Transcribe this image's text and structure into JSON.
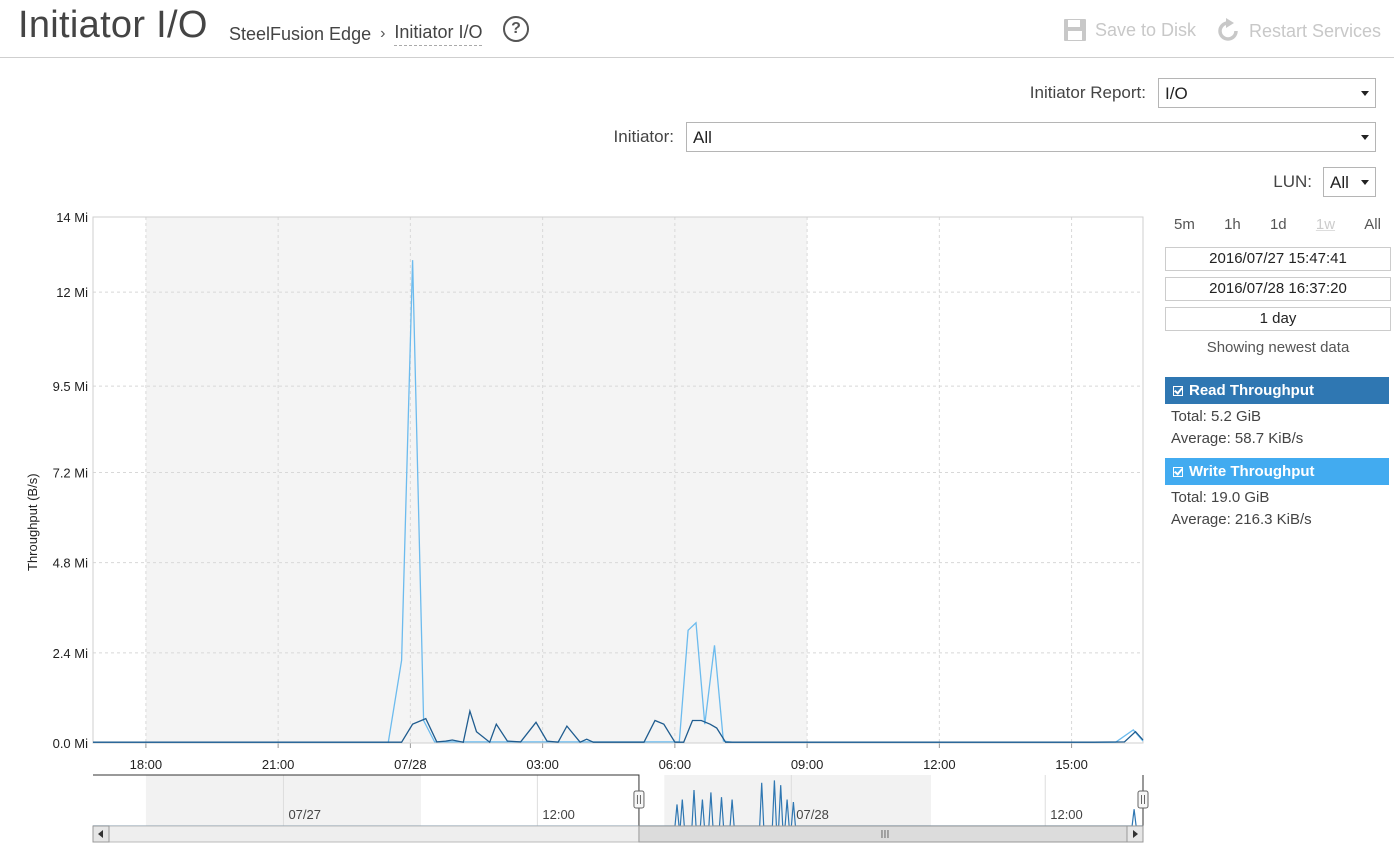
{
  "header": {
    "title": "Initiator I/O",
    "breadcrumb": {
      "parent": "SteelFusion Edge",
      "separator": "›",
      "current": "Initiator I/O"
    },
    "help_icon": "question-circle-icon",
    "save_label": "Save to Disk",
    "save_icon": "floppy-disk-icon",
    "restart_label": "Restart Services",
    "restart_icon": "refresh-icon",
    "disabled_color": "#c8c8c8"
  },
  "filters": {
    "initiator_report": {
      "label": "Initiator Report:",
      "value": "I/O"
    },
    "initiator": {
      "label": "Initiator:",
      "value": "All"
    },
    "lun": {
      "label": "LUN:",
      "value": "All"
    }
  },
  "range_panel": {
    "buttons": [
      "5m",
      "1h",
      "1d",
      "1w",
      "All"
    ],
    "disabled_button": "1w",
    "start": "2016/07/27 15:47:41",
    "end": "2016/07/28 16:37:20",
    "duration": "1 day",
    "status": "Showing newest data"
  },
  "series_stats": {
    "read": {
      "label": "Read Throughput",
      "total": "Total: 5.2 GiB",
      "average": "Average: 58.7 KiB/s",
      "color": "#2f77b2"
    },
    "write": {
      "label": "Write Throughput",
      "total": "Total: 19.0 GiB",
      "average": "Average: 216.3 KiB/s",
      "color": "#42abf0"
    }
  },
  "chart_data": {
    "type": "line",
    "ylabel": "Throughput (B/s)",
    "y_ticks": [
      "0.0 Mi",
      "2.4 Mi",
      "4.8 Mi",
      "7.2 Mi",
      "9.5 Mi",
      "12 Mi",
      "14 Mi"
    ],
    "y_tick_values": [
      0,
      2.4,
      4.8,
      7.2,
      9.5,
      12,
      14
    ],
    "ylim": [
      0,
      14
    ],
    "x_ticks": [
      "18:00",
      "21:00",
      "07/28",
      "03:00",
      "06:00",
      "09:00",
      "12:00",
      "15:00"
    ],
    "x_tick_values": [
      18,
      21,
      24,
      27,
      30,
      33,
      36,
      39
    ],
    "xlim": [
      16.8,
      40.62
    ],
    "shaded_range": [
      18.0,
      33.0
    ],
    "grid": true,
    "series": [
      {
        "name": "Write Throughput",
        "color": "#6cbbee",
        "x": [
          16.8,
          23.5,
          23.8,
          24.05,
          24.3,
          24.55,
          29.0,
          30.1,
          30.3,
          30.48,
          30.68,
          30.9,
          31.1,
          31.3,
          40.0,
          40.4,
          40.62
        ],
        "y": [
          0.02,
          0.02,
          2.2,
          12.85,
          0.6,
          0.03,
          0.03,
          0.03,
          3.0,
          3.2,
          0.5,
          2.6,
          0.05,
          0.02,
          0.02,
          0.35,
          0.05
        ]
      },
      {
        "name": "Read Throughput",
        "color": "#1f5c8f",
        "x": [
          16.8,
          23.8,
          24.05,
          24.35,
          24.6,
          24.8,
          24.95,
          25.2,
          25.35,
          25.5,
          25.8,
          25.95,
          26.2,
          26.5,
          26.85,
          27.1,
          27.35,
          27.55,
          27.85,
          28.0,
          28.15,
          28.5,
          29.3,
          29.55,
          29.75,
          30.0,
          30.2,
          30.4,
          30.6,
          30.8,
          30.95,
          31.15,
          32.0,
          39.5,
          40.2,
          40.45,
          40.62
        ],
        "y": [
          0.02,
          0.02,
          0.5,
          0.65,
          0.03,
          0.05,
          0.08,
          0.02,
          0.85,
          0.3,
          0.02,
          0.5,
          0.05,
          0.03,
          0.55,
          0.05,
          0.02,
          0.45,
          0.02,
          0.1,
          0.02,
          0.02,
          0.02,
          0.6,
          0.5,
          0.02,
          0.02,
          0.6,
          0.6,
          0.5,
          0.4,
          0.02,
          0.02,
          0.02,
          0.03,
          0.3,
          0.08
        ]
      }
    ]
  },
  "navigator": {
    "labels": [
      "07/27",
      "12:00",
      "07/28",
      "12:00"
    ],
    "label_values": [
      0.0,
      12.0,
      24.0,
      36.0
    ],
    "xlim": [
      -9.0,
      40.62
    ],
    "shaded_ranges": [
      [
        -6.5,
        6.5
      ],
      [
        18.0,
        30.6
      ]
    ],
    "window": [
      16.8,
      40.62
    ],
    "scroll_left_icon": "chevron-left-icon",
    "scroll_right_icon": "chevron-right-icon",
    "grip_icon": "grip-lines-icon",
    "line_color": "#2f77b2",
    "spikes": [
      {
        "x": 18.6,
        "y": 0.45
      },
      {
        "x": 18.85,
        "y": 0.55
      },
      {
        "x": 19.4,
        "y": 0.75
      },
      {
        "x": 19.8,
        "y": 0.55
      },
      {
        "x": 20.2,
        "y": 0.7
      },
      {
        "x": 20.7,
        "y": 0.6
      },
      {
        "x": 21.2,
        "y": 0.55
      },
      {
        "x": 22.6,
        "y": 0.9
      },
      {
        "x": 23.2,
        "y": 0.95
      },
      {
        "x": 23.5,
        "y": 0.85
      },
      {
        "x": 23.8,
        "y": 0.55
      },
      {
        "x": 24.1,
        "y": 0.5
      },
      {
        "x": 40.2,
        "y": 0.35
      }
    ]
  }
}
